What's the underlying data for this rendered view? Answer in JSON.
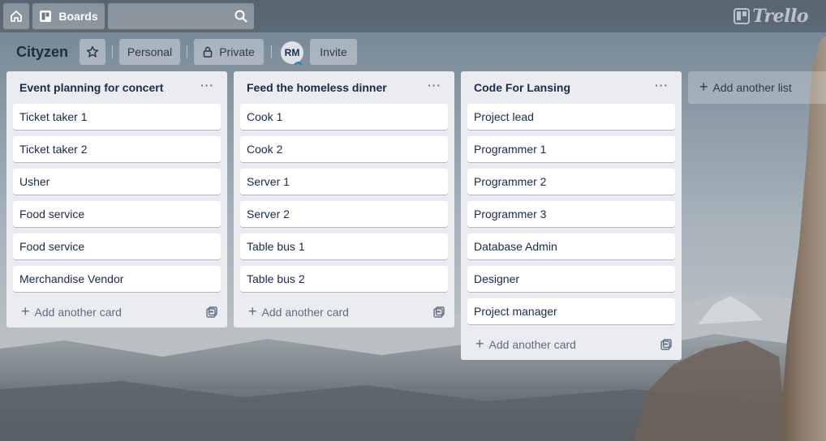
{
  "header": {
    "boards_label": "Boards",
    "search_placeholder": "",
    "logo_text": "Trello",
    "icons": {
      "home": "home-icon",
      "boards": "boards-icon",
      "search": "search-icon",
      "logo": "trello-logo-icon"
    }
  },
  "board": {
    "title": "Cityzen",
    "personal_label": "Personal",
    "private_label": "Private",
    "member_initials": "RM",
    "invite_label": "Invite"
  },
  "lists": [
    {
      "title": "Event planning for concert",
      "menu": "···",
      "cards": [
        "Ticket taker 1",
        "Ticket taker 2",
        "Usher",
        "Food service",
        "Food service",
        "Merchandise Vendor"
      ],
      "add_card_label": "Add another card"
    },
    {
      "title": "Feed the homeless dinner",
      "menu": "···",
      "cards": [
        "Cook 1",
        "Cook 2",
        "Server 1",
        "Server 2",
        "Table bus 1",
        "Table bus 2"
      ],
      "add_card_label": "Add another card"
    },
    {
      "title": "Code For Lansing",
      "menu": "···",
      "cards": [
        "Project lead",
        "Programmer 1",
        "Programmer 2",
        "Programmer 3",
        "Database Admin",
        "Designer",
        "Project manager"
      ],
      "add_card_label": "Add another card"
    }
  ],
  "add_list_label": "Add another list",
  "colors": {
    "list_bg": "#ebecf0",
    "card_bg": "#ffffff",
    "text": "#172b4d",
    "muted": "#5e6c84"
  }
}
